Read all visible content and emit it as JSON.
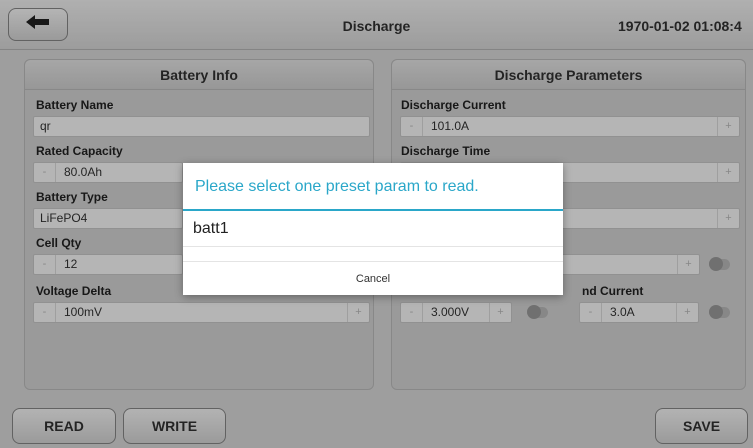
{
  "header": {
    "title": "Discharge",
    "datetime": "1970-01-02 01:08:4"
  },
  "battery_info": {
    "heading": "Battery Info",
    "battery_name_label": "Battery Name",
    "battery_name_value": "qr",
    "rated_capacity_label": "Rated Capacity",
    "rated_capacity_value": "80.0Ah",
    "battery_type_label": "Battery Type",
    "battery_type_value": "LiFePO4",
    "cell_qty_label": "Cell Qty",
    "cell_qty_value": "12",
    "voltage_delta_label": "Voltage Delta",
    "voltage_delta_value": "100mV"
  },
  "discharge_params": {
    "heading": "Discharge Parameters",
    "discharge_current_label": "Discharge Current",
    "discharge_current_value": "101.0A",
    "discharge_time_label": "Discharge Time",
    "end_voltage_value": "3.000V",
    "end_current_label": "nd Current",
    "end_current_value": "3.0A"
  },
  "stepper": {
    "minus": "-",
    "plus": "+"
  },
  "footer": {
    "read_label": "READ",
    "write_label": "WRITE",
    "save_label": "SAVE"
  },
  "dialog": {
    "title": "Please select one preset param to read.",
    "items": [
      "batt1"
    ],
    "cancel_label": "Cancel"
  },
  "colors": {
    "accent": "#2aa7c9",
    "panel": "#d6d6d6"
  },
  "icons": {
    "back": "back-arrow-icon"
  }
}
